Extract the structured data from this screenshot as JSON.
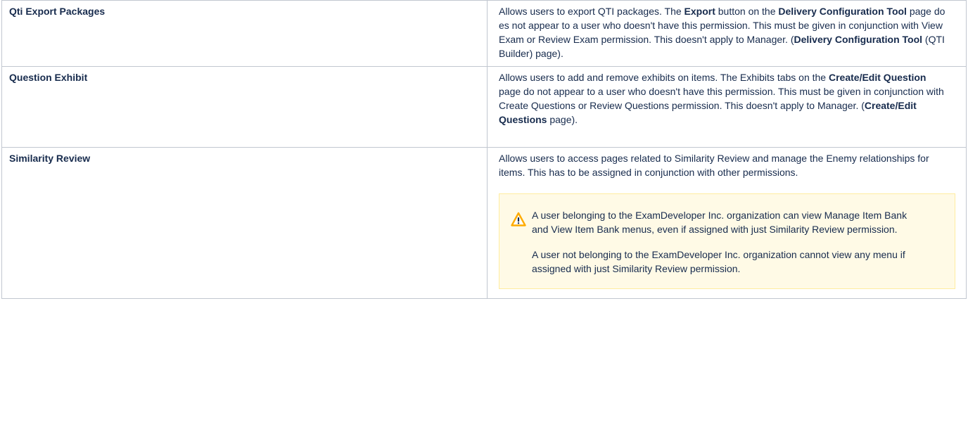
{
  "rows": [
    {
      "name": "Qti Export Packages",
      "desc": {
        "t1": "Allows users to export QTI packages. The ",
        "b1": "Export",
        "t2": " button on the ",
        "b2": "Delivery Configuration Tool",
        "t3": " page does not appear to a user who doesn't have this permission. This must be given in conjunction with View Exam or Review Exam permission. This doesn't apply to Manager. (",
        "b3": "Delivery Configuration Tool",
        "t4": " (QTI Builder) page)."
      }
    },
    {
      "name": "Question Exhibit",
      "desc": {
        "t1": "Allows users to add and remove exhibits on items. The Exhibits tabs on the ",
        "b1": "Create/Edit Question",
        "t2": " page do not appear to a user who doesn't have this permission. This must be given in conjunction with Create Questions or Review Questions permission. This doesn't apply to Manager. (",
        "b2": "Create/Edit Questions",
        "t3": " page)."
      }
    },
    {
      "name": "Similarity Review",
      "desc": "Allows users to access pages related to Similarity Review and manage the Enemy relationships for items. This has to be assigned in conjunction with other permissions.",
      "warning": {
        "icon": "warning-icon",
        "p1": "A user belonging to the ExamDeveloper Inc. organization can view Manage Item Bank and View Item Bank menus, even if assigned with just Similarity Review permission.",
        "p2": "A user not belonging to the ExamDeveloper Inc. organization cannot view any menu if assigned with just Similarity Review permission."
      }
    }
  ],
  "colors": {
    "border": "#c1c7d0",
    "text": "#172b4d",
    "warning_bg": "#fffae6",
    "warning_border": "#ffeca0",
    "warning_icon": "#ffab00"
  }
}
